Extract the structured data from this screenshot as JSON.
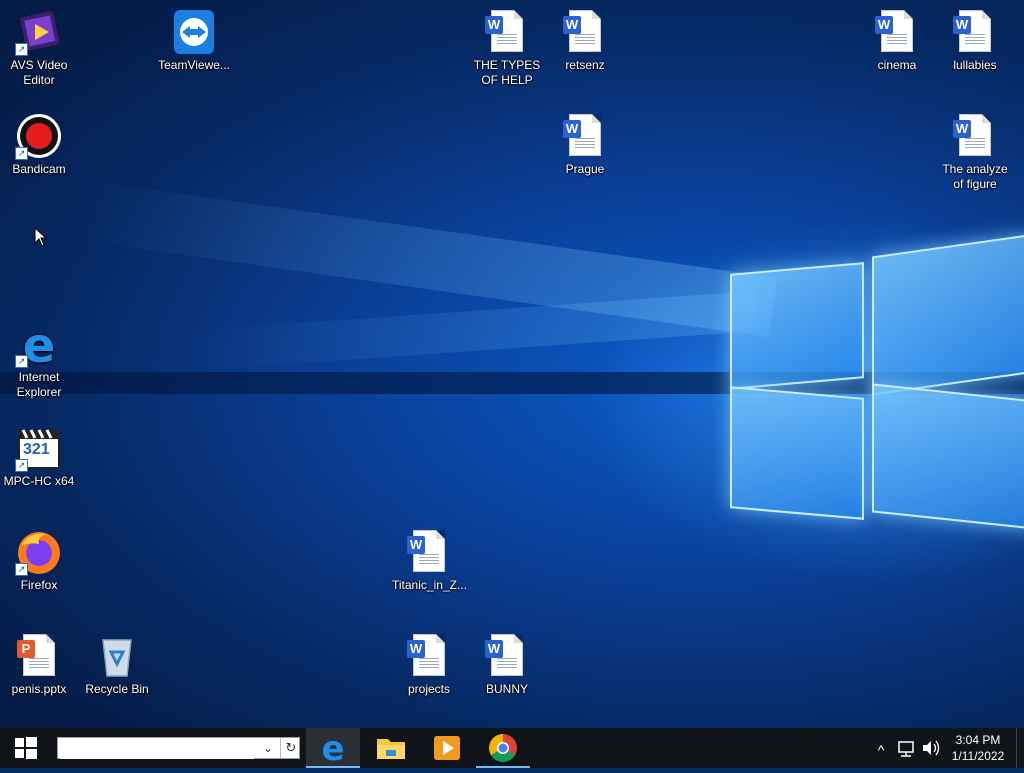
{
  "desktop": {
    "icons": {
      "avs": {
        "label_line1": "AVS Video",
        "label_line2": "Editor"
      },
      "teamviewer": {
        "label": "TeamViewe..."
      },
      "types_of_help": {
        "label_line1": "THE TYPES",
        "label_line2": "OF HELP",
        "badge": "W"
      },
      "retsenz": {
        "label": "retsenz",
        "badge": "W"
      },
      "cinema": {
        "label": "cinema",
        "badge": "W"
      },
      "lullabies": {
        "label": "lullabies",
        "badge": "W"
      },
      "bandicam": {
        "label": "Bandicam"
      },
      "prague": {
        "label": "Prague",
        "badge": "W"
      },
      "analyze_figure": {
        "label_line1": "The analyze",
        "label_line2": "of figure",
        "badge": "W"
      },
      "internet_explorer": {
        "label_line1": "Internet",
        "label_line2": "Explorer"
      },
      "mpc": {
        "label": "MPC-HC x64",
        "badge_text": "321"
      },
      "firefox": {
        "label": "Firefox"
      },
      "titanic": {
        "label": "Titanic_in_Z...",
        "badge": "W"
      },
      "penis_pptx": {
        "label": "penis.pptx",
        "badge": "P"
      },
      "recycle_bin": {
        "label": "Recycle Bin"
      },
      "projects": {
        "label": "projects",
        "badge": "W"
      },
      "bunny": {
        "label": "BUNNY",
        "badge": "W"
      }
    },
    "shortcut_arrow": "↗"
  },
  "taskbar": {
    "search": {
      "value": "",
      "placeholder": ""
    },
    "dropdown_glyph": "⌄",
    "refresh_glyph": "↻",
    "tray": {
      "chevron": "^",
      "network_icon": "network-icon",
      "volume_icon": "volume-icon"
    },
    "clock": {
      "time": "3:04 PM",
      "date": "1/11/2022"
    }
  },
  "colors": {
    "taskbar": "#101418",
    "accent": "#76b9ed",
    "word_blue": "#2a62d4",
    "ppt_orange": "#e15a2d"
  }
}
